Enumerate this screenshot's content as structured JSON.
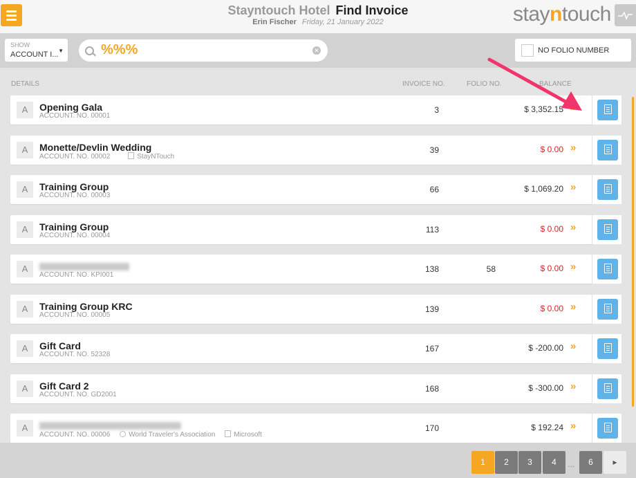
{
  "header": {
    "hotel": "Stayntouch Hotel",
    "page_title": "Find Invoice",
    "user": "Erin Fischer",
    "date": "Friday, 21 January 2022",
    "logo_left": "stay",
    "logo_mid": "n",
    "logo_right": "touch"
  },
  "filters": {
    "show_label": "SHOW",
    "show_value": "ACCOUNT I...",
    "search_value": "%%%",
    "no_folio_label": "NO FOLIO NUMBER"
  },
  "columns": {
    "details": "DETAILS",
    "invoice": "INVOICE NO.",
    "folio": "FOLIO NO.",
    "balance": "BALANCE"
  },
  "rows": [
    {
      "type": "A",
      "name": "Opening Gala",
      "account": "ACCOUNT. NO. 00001",
      "invoice": "3",
      "folio": "",
      "balance": "$ 3,352.15"
    },
    {
      "type": "A",
      "name": "Monette/Devlin Wedding",
      "account": "ACCOUNT. NO. 00002",
      "company": "StayNTouch",
      "invoice": "39",
      "folio": "",
      "balance": "$ 0.00"
    },
    {
      "type": "A",
      "name": "Training Group",
      "account": "ACCOUNT. NO. 00003",
      "invoice": "66",
      "folio": "",
      "balance": "$ 1,069.20"
    },
    {
      "type": "A",
      "name": "Training Group",
      "account": "ACCOUNT. NO. 00004",
      "invoice": "113",
      "folio": "",
      "balance": "$ 0.00"
    },
    {
      "type": "A",
      "name": "",
      "account": "ACCOUNT. NO. KPI001",
      "invoice": "138",
      "folio": "58",
      "balance": "$ 0.00"
    },
    {
      "type": "A",
      "name": "Training Group KRC",
      "account": "ACCOUNT. NO. 00005",
      "invoice": "139",
      "folio": "",
      "balance": "$ 0.00"
    },
    {
      "type": "A",
      "name": "Gift Card",
      "account": "ACCOUNT. NO. 52328",
      "invoice": "167",
      "folio": "",
      "balance": "$ -200.00"
    },
    {
      "type": "A",
      "name": "Gift Card 2",
      "account": "ACCOUNT. NO. GD2001",
      "invoice": "168",
      "folio": "",
      "balance": "$ -300.00"
    },
    {
      "type": "A",
      "name": "",
      "account": "ACCOUNT. NO. 00006",
      "travel_agent": "World Traveler's Association",
      "company": "Microsoft",
      "invoice": "170",
      "folio": "",
      "balance": "$ 192.24"
    }
  ],
  "pagination": {
    "pages": [
      "1",
      "2",
      "3",
      "4",
      "6"
    ],
    "active": "1",
    "ellipsis": "...",
    "next": "▸"
  },
  "colors": {
    "accent": "#f5a623",
    "invoice_button": "#5fb3e8",
    "zero_balance": "#e02020",
    "annotation_arrow": "#f0356b"
  }
}
